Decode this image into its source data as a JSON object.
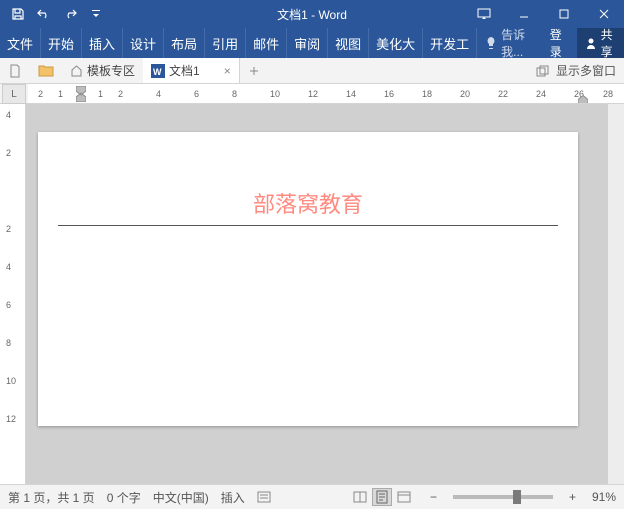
{
  "title": "文档1 - Word",
  "ribbon": {
    "tabs": [
      "文件",
      "开始",
      "插入",
      "设计",
      "布局",
      "引用",
      "邮件",
      "审阅",
      "视图",
      "美化大",
      "开发工"
    ],
    "tell_me": "告诉我...",
    "login": "登录",
    "share": "共享"
  },
  "tabbar": {
    "templates": "模板专区",
    "doc": "文档1",
    "multi_window": "显示多窗口"
  },
  "ruler": {
    "corner": "L",
    "h_marks": [
      "2",
      "1",
      "1",
      "2",
      "4",
      "6",
      "8",
      "10",
      "12",
      "14",
      "16",
      "18",
      "20",
      "22",
      "24",
      "26",
      "28"
    ],
    "v_marks": [
      "4",
      "2",
      "2",
      "4",
      "6",
      "8",
      "10",
      "12"
    ]
  },
  "document": {
    "header": "部落窝教育"
  },
  "status": {
    "page": "第 1 页，共 1 页",
    "words": "0 个字",
    "lang": "中文(中国)",
    "mode": "插入",
    "zoom": "91%"
  }
}
